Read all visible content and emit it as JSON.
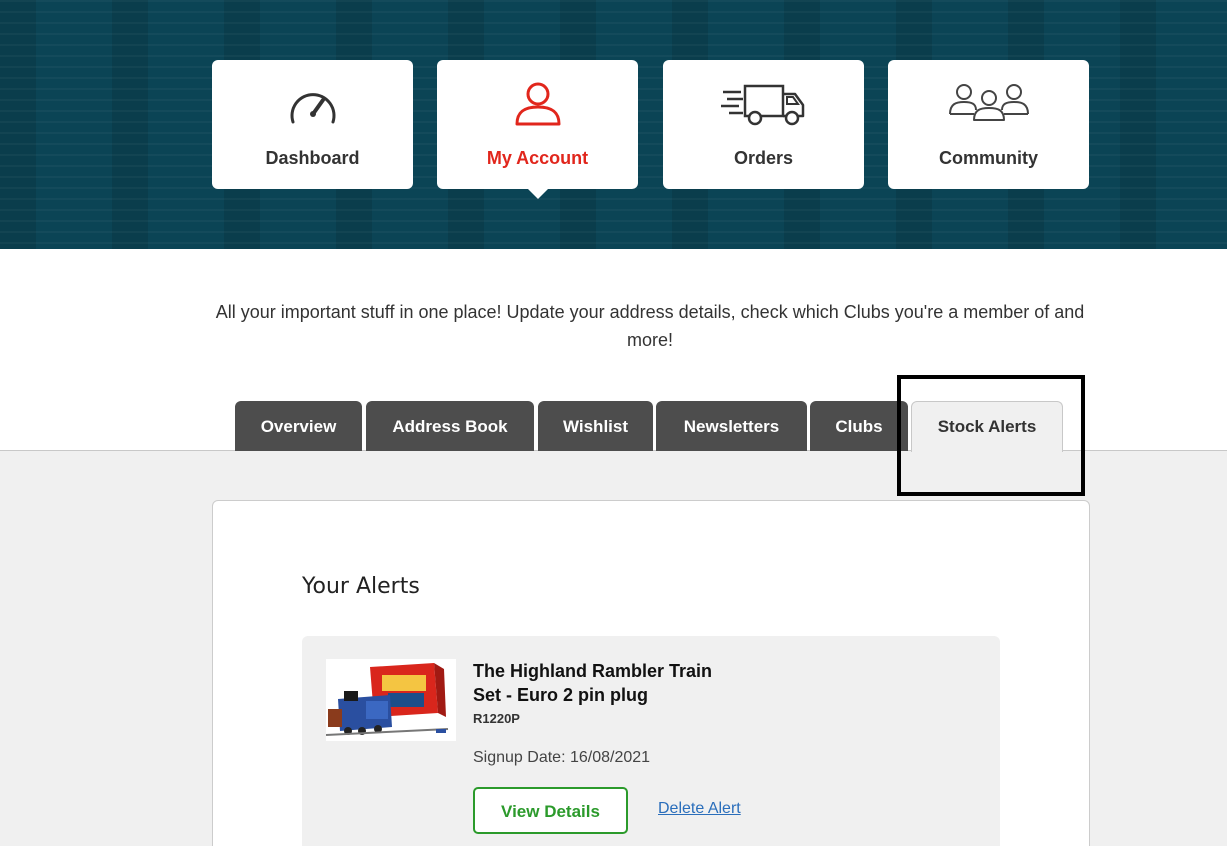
{
  "nav": {
    "cards": [
      {
        "label": "Dashboard",
        "icon": "speedometer-icon"
      },
      {
        "label": "My Account",
        "icon": "user-icon"
      },
      {
        "label": "Orders",
        "icon": "delivery-truck-icon"
      },
      {
        "label": "Community",
        "icon": "people-group-icon"
      }
    ],
    "active": "My Account"
  },
  "intro": {
    "text": "All your important stuff in one place! Update your address details, check which Clubs you're a member of and more!"
  },
  "tabs": {
    "items": [
      "Overview",
      "Address Book",
      "Wishlist",
      "Newsletters",
      "Clubs",
      "Stock Alerts"
    ],
    "active": "Stock Alerts"
  },
  "alerts": {
    "title": "Your Alerts",
    "items": [
      {
        "name": "The Highland Rambler Train Set - Euro 2 pin plug",
        "code": "R1220P",
        "signup": "Signup Date: 16/08/2021",
        "view_label": "View Details",
        "delete_label": "Delete Alert"
      }
    ]
  },
  "colors": {
    "hero_bg": "#0b4455",
    "accent_red": "#e1261c",
    "tab_dark": "#4d4d4d",
    "button_green": "#2b9a2b",
    "link_blue": "#2a6ebb"
  }
}
